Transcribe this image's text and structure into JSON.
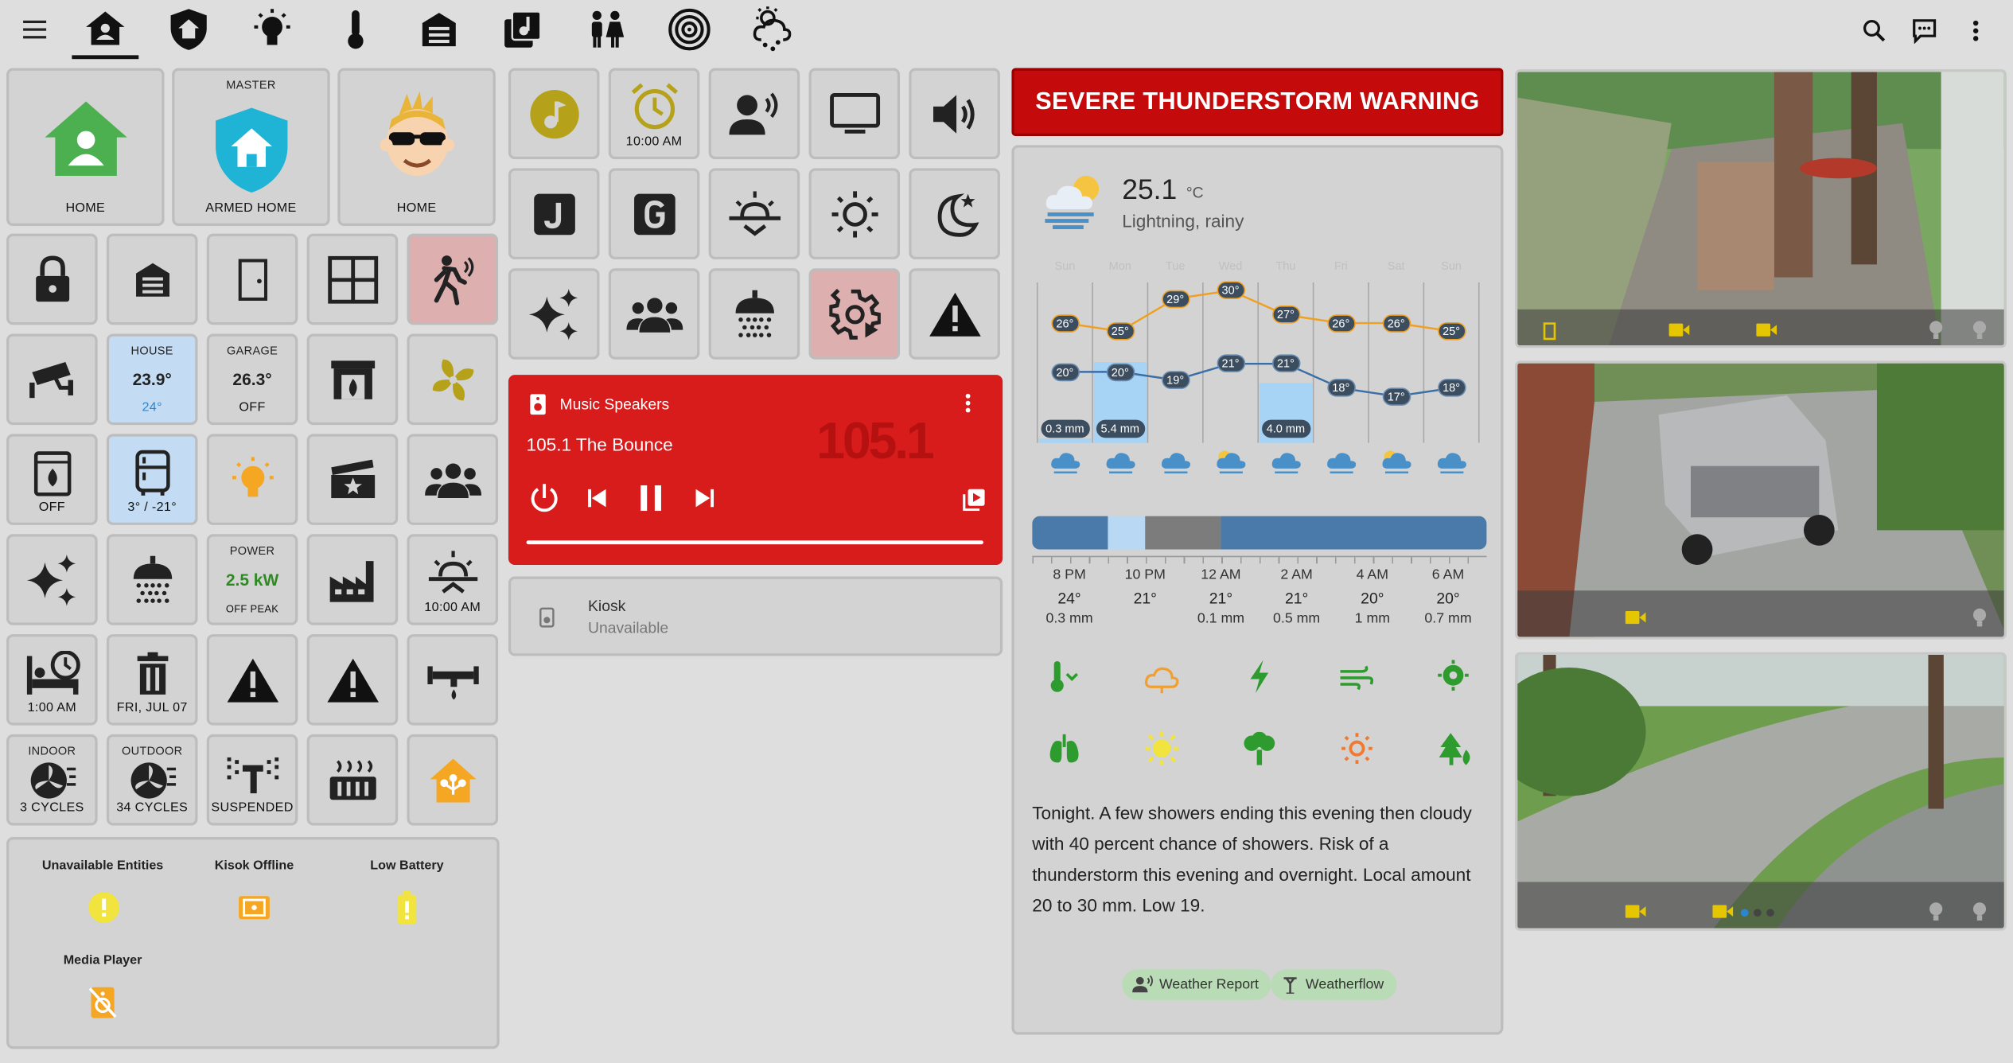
{
  "colors": {
    "accent_green": "#4caf50",
    "alert_red": "#c40a0a",
    "music_red": "#d81b1b",
    "tile_gray": "#d3d3d3",
    "tile_blue": "#c4dcf3",
    "tile_pink": "#ddafaf"
  },
  "tabs": [
    "menu-icon",
    "home-icon",
    "shield-home-icon",
    "lightbulb-icon",
    "thermometer-icon",
    "garage-icon",
    "music-library-icon",
    "people-icon",
    "speaker-icon",
    "weather-snowy-icon"
  ],
  "home_tiles": [
    {
      "top": "",
      "bottom": "HOME"
    },
    {
      "top": "MASTER",
      "bottom": "ARMED HOME"
    },
    {
      "top": "",
      "bottom": "HOME"
    }
  ],
  "house": {
    "top": "HOUSE",
    "value": "23.9°",
    "bottom": "24°"
  },
  "garage": {
    "top": "GARAGE",
    "value": "26.3°",
    "bottom": "OFF"
  },
  "washer": {
    "bottom": "OFF"
  },
  "fridge": {
    "bottom": "3° / -21°"
  },
  "power": {
    "top": "POWER",
    "value": "2.5 kW",
    "bottom": "OFF PEAK"
  },
  "sunrise_tile": {
    "bottom": "10:00 AM"
  },
  "bed_alarm": {
    "bottom": "1:00 AM"
  },
  "trash": {
    "bottom": "FRI, JUL 07"
  },
  "indoor": {
    "top": "INDOOR",
    "bottom": "3 CYCLES"
  },
  "outdoor": {
    "top": "OUTDOOR",
    "bottom": "34 CYCLES"
  },
  "sprinkler": {
    "bottom": "SUSPENDED"
  },
  "alerts": {
    "unavailable": "Unavailable Entities",
    "kiosk_offline": "Kisok Offline",
    "low_battery": "Low Battery",
    "media_player": "Media Player"
  },
  "alarm_tile": {
    "bottom": "10:00 AM"
  },
  "music": {
    "title": "Music Speakers",
    "station": "105.1 The Bounce",
    "art": "105.1"
  },
  "kiosk": {
    "name": "Kiosk",
    "state": "Unavailable"
  },
  "warning": {
    "text": "SEVERE THUNDERSTORM WARNING"
  },
  "weather": {
    "temp": "25.1",
    "unit": "°C",
    "condition": "Lightning, rainy",
    "days": [
      "Sun",
      "Mon",
      "Tue",
      "Wed",
      "Thu",
      "Fri",
      "Sat",
      "Sun"
    ],
    "highs": [
      "26°",
      "25°",
      "29°",
      "30°",
      "27°",
      "26°",
      "26°",
      "25°"
    ],
    "lows": [
      "20°",
      "20°",
      "19°",
      "21°",
      "21°",
      "18°",
      "17°",
      "18°"
    ],
    "precip": [
      "0.3 mm",
      "5.4 mm",
      "",
      "",
      "4.0 mm",
      "",
      "",
      ""
    ],
    "hourly": [
      {
        "time": "8 PM",
        "temp": "24°",
        "precip": "0.3 mm"
      },
      {
        "time": "10 PM",
        "temp": "21°",
        "precip": ""
      },
      {
        "time": "12 AM",
        "temp": "21°",
        "precip": "0.1 mm"
      },
      {
        "time": "2 AM",
        "temp": "21°",
        "precip": "0.5 mm"
      },
      {
        "time": "4 AM",
        "temp": "20°",
        "precip": "1 mm"
      },
      {
        "time": "6 AM",
        "temp": "20°",
        "precip": "0.7 mm"
      }
    ],
    "forecast_text": "Tonight. A few showers ending this evening then cloudy with 40 percent chance of showers. Risk of a thunderstorm this evening and overnight. Local amount 20 to 30 mm. Low 19.",
    "chip1": "Weather Report",
    "chip2": "Weatherflow"
  }
}
